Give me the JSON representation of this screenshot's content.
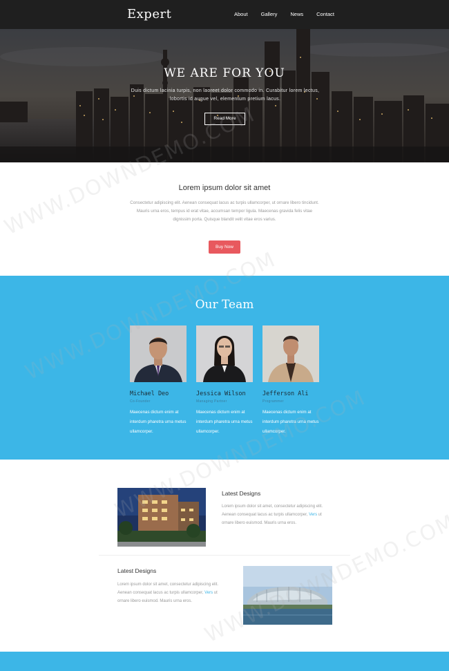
{
  "header": {
    "logo": "Expert",
    "nav": [
      "About",
      "Gallery",
      "News",
      "Contact"
    ]
  },
  "hero": {
    "title": "WE ARE FOR YOU",
    "subtitle": "Duis dictum lacinia turpis, non laoreet dolor commodo in. Curabitur lorem lectus, lobortis id augue vel, elementum pretium lacus.",
    "button": "Read More"
  },
  "intro": {
    "title": "Lorem ipsum dolor sit amet",
    "text": "Consectetur adipiscing elit. Aenean consequat lacus ac turpis ullamcorper, ut ornare libero tincidunt. Mauris urna eros, tempus id erat vitae, accumsan tempor ligula. Maecenas gravida felis vitae dignissim porta. Quisque blandit velit vitae eros varius.",
    "button": "Buy Now"
  },
  "team": {
    "title": "Our Team",
    "members": [
      {
        "name": "Michael Deo",
        "role": "Co-Founder",
        "text": "Maecenas dictum enim at interdum pharetra urna metus ullamcorper."
      },
      {
        "name": "Jessica Wilson",
        "role": "Managing Partner",
        "text": "Maecenas dictum enim at interdum pharetra urna metus ullamcorper."
      },
      {
        "name": "Jefferson Ali",
        "role": "Programmer",
        "text": "Maecenas dictum enim at interdum pharetra urna metus ullamcorper."
      }
    ]
  },
  "features": [
    {
      "title": "Latest Designs",
      "text": "Lorem ipsum dolor sit amet, consectetur adipiscing elit. Aenean consequat lacus ac turpis ullamcorper,",
      "link": "Vers",
      "text_end": "ut ornare libero euismod. Mauris urna eros."
    },
    {
      "title": "Latest Designs",
      "text": "Lorem ipsum dolor sit amet, consectetur adipiscing elit. Aenean consequat lacus ac turpis ullamcorper,",
      "link": "Vers",
      "text_end": "ut ornare libero euismod. Mauris urna eros."
    }
  ],
  "watermark": "WWW.DOWNDEMO.COM"
}
